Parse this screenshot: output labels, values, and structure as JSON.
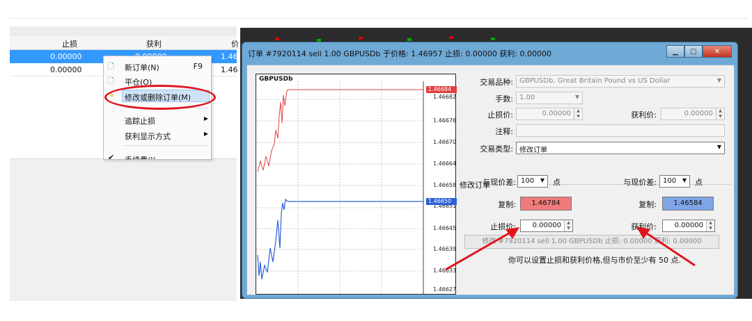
{
  "colors": {
    "accent": "#3399ff",
    "highlight_oval": "#e0141d",
    "ask_red": "#ef7b7b",
    "bid_blue": "#7ea6e6"
  },
  "order_table": {
    "headers": [
      "止损",
      "获利",
      "价"
    ],
    "rows": [
      {
        "stoploss": "0.00000",
        "takeprofit": "0.00000",
        "price": "1.46"
      },
      {
        "stoploss": "0.00000",
        "takeprofit": "",
        "price": "1.46"
      }
    ]
  },
  "context_menu": {
    "items": [
      {
        "label": "新订单(N)",
        "shortcut": "F9",
        "icon": "new-order-icon"
      },
      {
        "label": "平仓(O)",
        "shortcut": "",
        "icon": "close-position-icon"
      },
      {
        "label": "修改或删除订单(M)",
        "shortcut": "",
        "icon": "modify-order-icon"
      },
      {
        "label": "追踪止损",
        "shortcut": "",
        "icon": ""
      },
      {
        "label": "获利显示方式",
        "shortcut": "",
        "icon": ""
      },
      {
        "label": "手续费(I)",
        "shortcut": "",
        "icon": "check-icon"
      }
    ]
  },
  "dialog": {
    "title": "订单 #7920114 sell 1.00 GBPUSDb 于价格: 1.46957 止损: 0.00000 获利: 0.00000",
    "chart": {
      "symbol": "GBPUSDb",
      "ticks": [
        "1.46682",
        "1.46676",
        "1.46670",
        "1.46664",
        "1.46658",
        "1.46651",
        "1.46645",
        "1.46639",
        "1.46633",
        "1.46627"
      ],
      "ask_price": "1.46684",
      "bid_price": "1.46650"
    },
    "fields": {
      "symbol_label": "交易品种:",
      "symbol_value": "GBPUSDb, Great Britain Pound vs US Dollar",
      "volume_label": "手数:",
      "volume_value": "1.00",
      "sl_label": "止损价:",
      "sl_value": "0.00000",
      "tp_label": "获利价:",
      "tp_value": "0.00000",
      "comment_label": "注释:",
      "comment_value": "",
      "type_label": "交易类型:",
      "type_value": "修改订单"
    },
    "modify_group": {
      "title": "修改订单",
      "left": {
        "diff_label": "与现价差:",
        "diff_value": "100",
        "unit": "点",
        "copy_label": "复制:",
        "copy_value": "1.46784",
        "price_label": "止损价:",
        "price_value": "0.00000"
      },
      "right": {
        "diff_label": "与现价差:",
        "diff_value": "100",
        "unit": "点",
        "copy_label": "复制:",
        "copy_value": "1.46584",
        "price_label": "获利价:",
        "price_value": "0.00000"
      },
      "modify_button": "修改 #7920114 sell 1.00 GBPUSDb 止损: 0.00000 获利: 0.00000",
      "hint": "你可以设置止损和获利价格,但与市价至少有 50 点."
    }
  }
}
